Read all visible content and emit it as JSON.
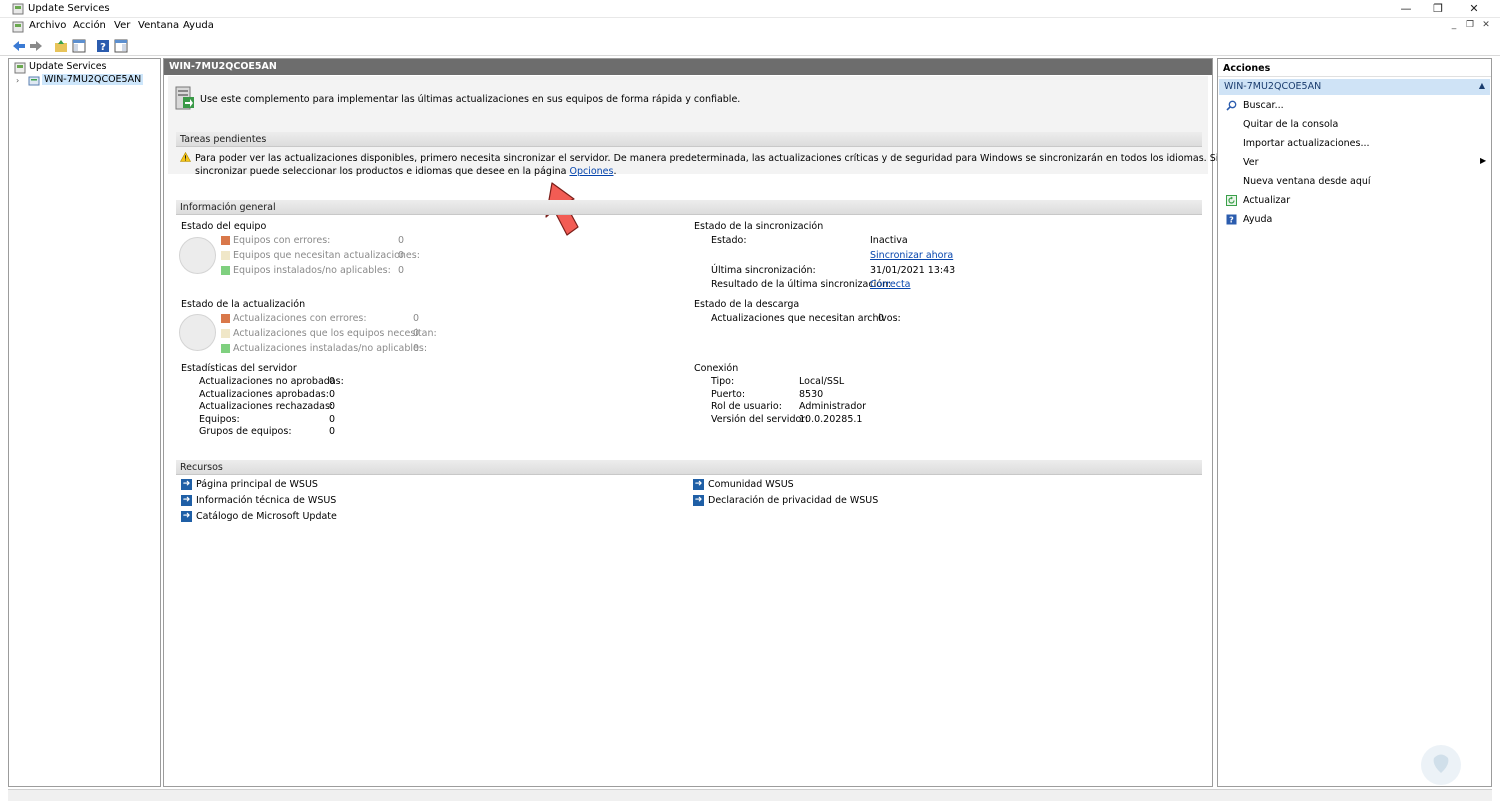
{
  "window": {
    "title": "Update Services",
    "minimize": "—",
    "restore": "❐",
    "close": "✕"
  },
  "menu": [
    "Archivo",
    "Acción",
    "Ver",
    "Ventana",
    "Ayuda"
  ],
  "tree": {
    "root": "Update Services",
    "server": "WIN-7MU2QCOE5AN"
  },
  "center": {
    "header": "WIN-7MU2QCOE5AN",
    "intro": "Use este complemento para implementar las últimas actualizaciones en sus equipos de forma rápida y confiable.",
    "pending": {
      "title": "Tareas pendientes",
      "line1": "Para poder ver las actualizaciones disponibles, primero necesita sincronizar el servidor. De manera predeterminada, las actualizaciones críticas y de seguridad para Windows se sincronizarán en todos los idiomas. Sin embargo, antes de",
      "line2": "sincronizar puede seleccionar los productos e idiomas que desee en la página",
      "link": "Opciones",
      "after": "."
    },
    "overview": {
      "title": "Información general",
      "computer_status": {
        "title": "Estado del equipo",
        "rows": [
          {
            "label": "Equipos con errores:",
            "value": "0",
            "color": "#d9784a"
          },
          {
            "label": "Equipos que necesitan actualizaciones:",
            "value": "0",
            "color": "#f0e7c8"
          },
          {
            "label": "Equipos instalados/no aplicables:",
            "value": "0",
            "color": "#7fd07f"
          }
        ]
      },
      "update_status": {
        "title": "Estado de la actualización",
        "rows": [
          {
            "label": "Actualizaciones con errores:",
            "value": "0",
            "color": "#d9784a"
          },
          {
            "label": "Actualizaciones que los equipos necesitan:",
            "value": "0",
            "color": "#f0e7c8"
          },
          {
            "label": "Actualizaciones instaladas/no aplicables:",
            "value": "0",
            "color": "#7fd07f"
          }
        ]
      },
      "server_stats": {
        "title": "Estadísticas del servidor",
        "rows": [
          {
            "label": "Actualizaciones no aprobadas:",
            "value": "0"
          },
          {
            "label": "Actualizaciones aprobadas:",
            "value": "0"
          },
          {
            "label": "Actualizaciones rechazadas:",
            "value": "0"
          },
          {
            "label": "Equipos:",
            "value": "0"
          },
          {
            "label": "Grupos de equipos:",
            "value": "0"
          }
        ]
      },
      "sync_status": {
        "title": "Estado de la sincronización",
        "status_label": "Estado:",
        "status_value": "Inactiva",
        "sync_now": "Sincronizar ahora",
        "last_label": "Última sincronización:",
        "last_value": "31/01/2021 13:43",
        "result_label": "Resultado de la última sincronización:",
        "result_value": "Correcta"
      },
      "download_status": {
        "title": "Estado de la descarga",
        "label": "Actualizaciones que necesitan archivos:",
        "value": "0"
      },
      "connection": {
        "title": "Conexión",
        "rows": [
          {
            "label": "Tipo:",
            "value": "Local/SSL"
          },
          {
            "label": "Puerto:",
            "value": "8530"
          },
          {
            "label": "Rol de usuario:",
            "value": "Administrador"
          },
          {
            "label": "Versión del servidor:",
            "value": "10.0.20285.1"
          }
        ]
      }
    },
    "resources": {
      "title": "Recursos",
      "left": [
        "Página principal de WSUS",
        "Información técnica de WSUS",
        "Catálogo de Microsoft Update"
      ],
      "right": [
        "Comunidad WSUS",
        "Declaración de privacidad de WSUS"
      ]
    }
  },
  "actions": {
    "title": "Acciones",
    "server": "WIN-7MU2QCOE5AN",
    "items": [
      {
        "label": "Buscar...",
        "icon": "search-icon"
      },
      {
        "label": "Quitar de la consola",
        "icon": ""
      },
      {
        "label": "Importar actualizaciones...",
        "icon": ""
      },
      {
        "label": "Ver",
        "icon": ""
      },
      {
        "label": "Nueva ventana desde aquí",
        "icon": ""
      },
      {
        "label": "Actualizar",
        "icon": "refresh-icon"
      },
      {
        "label": "Ayuda",
        "icon": "help-icon"
      }
    ]
  },
  "colors": {
    "header_bg": "#6d6d6d",
    "actions_selected_bg": "#cfe3f6",
    "link": "#0645ad",
    "annotation_arrow": "#f25c54"
  }
}
